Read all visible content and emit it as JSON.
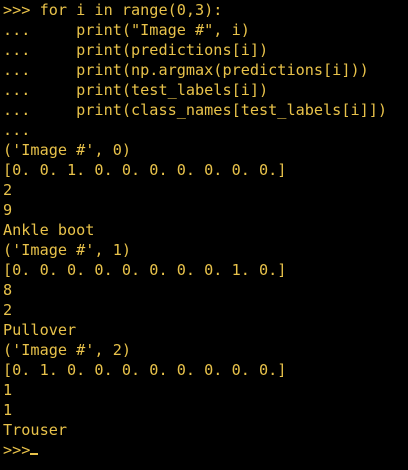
{
  "terminal": {
    "text_color": "#e8c24a",
    "background_color": "#000000",
    "lines": [
      ">>> for i in range(0,3):",
      "...     print(\"Image #\", i)",
      "...     print(predictions[i])",
      "...     print(np.argmax(predictions[i]))",
      "...     print(test_labels[i])",
      "...     print(class_names[test_labels[i]])",
      "...",
      "('Image #', 0)",
      "[0. 0. 1. 0. 0. 0. 0. 0. 0. 0.]",
      "2",
      "9",
      "Ankle boot",
      "('Image #', 1)",
      "[0. 0. 0. 0. 0. 0. 0. 0. 1. 0.]",
      "8",
      "2",
      "Pullover",
      "('Image #', 2)",
      "[0. 1. 0. 0. 0. 0. 0. 0. 0. 0.]",
      "1",
      "1",
      "Trouser"
    ],
    "prompt": ">>>"
  }
}
